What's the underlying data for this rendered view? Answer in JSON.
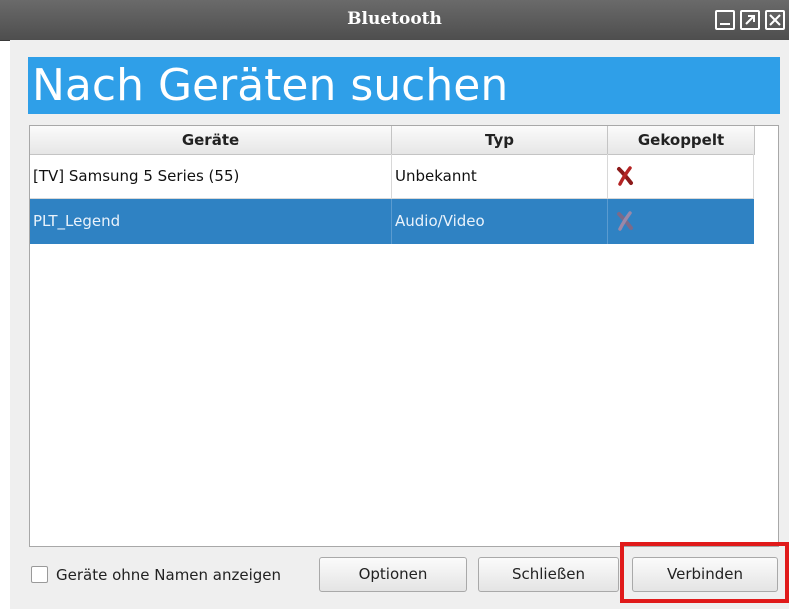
{
  "window": {
    "title": "Bluetooth"
  },
  "heading": "Nach Geräten suchen",
  "table": {
    "columns": [
      "Geräte",
      "Typ",
      "Gekoppelt"
    ],
    "rows": [
      {
        "device": "[TV] Samsung 5 Series (55)",
        "type": "Unbekannt",
        "paired_icon": "red-x-icon",
        "selected": false
      },
      {
        "device": "PLT_Legend",
        "type": "Audio/Video",
        "paired_icon": "red-x-icon",
        "selected": true
      }
    ]
  },
  "footer": {
    "checkbox_label": "Geräte ohne Namen anzeigen",
    "checkbox_checked": false,
    "options_label": "Optionen",
    "close_label": "Schließen",
    "connect_label": "Verbinden"
  },
  "colors": {
    "heading_bg": "#2f9fe8",
    "selected_row": "#2f82c3",
    "highlight": "#e01a1a"
  }
}
